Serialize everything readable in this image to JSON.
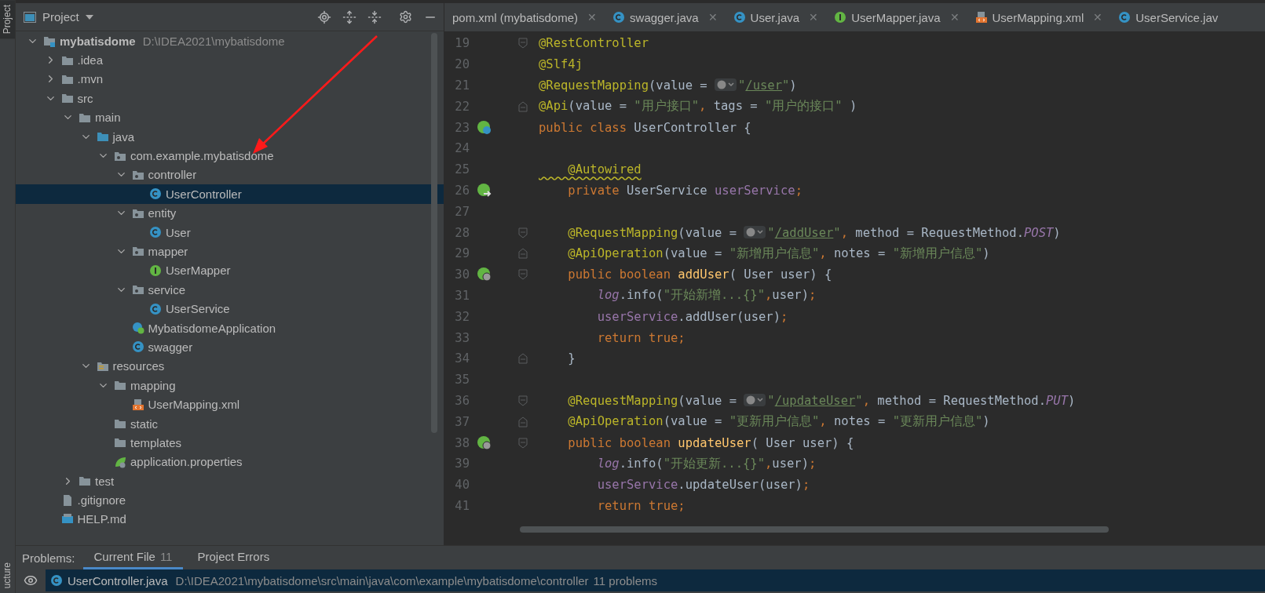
{
  "side_strip": {
    "top_tab": {
      "label": "Project",
      "selected": true
    },
    "bottom_tab": {
      "label": "ucture",
      "selected": false
    }
  },
  "project_panel": {
    "title": "Project",
    "tree": [
      {
        "label": "mybatisdome",
        "path": "D:\\IDEA2021\\mybatisdome",
        "kind": "module",
        "expanded": true,
        "selected": false,
        "children": [
          {
            "label": ".idea",
            "kind": "folder",
            "expanded": false,
            "selected": false
          },
          {
            "label": ".mvn",
            "kind": "folder",
            "expanded": false,
            "selected": false
          },
          {
            "label": "src",
            "kind": "folder",
            "expanded": true,
            "selected": false,
            "children": [
              {
                "label": "main",
                "kind": "folder",
                "expanded": true,
                "selected": false,
                "children": [
                  {
                    "label": "java",
                    "kind": "source",
                    "expanded": true,
                    "selected": false,
                    "children": [
                      {
                        "label": "com.example.mybatisdome",
                        "kind": "package",
                        "expanded": true,
                        "selected": false,
                        "children": [
                          {
                            "label": "controller",
                            "kind": "package",
                            "expanded": true,
                            "selected": false,
                            "children": [
                              {
                                "label": "UserController",
                                "kind": "class",
                                "selected": true
                              }
                            ]
                          },
                          {
                            "label": "entity",
                            "kind": "package",
                            "expanded": true,
                            "selected": false,
                            "children": [
                              {
                                "label": "User",
                                "kind": "class",
                                "selected": false
                              }
                            ]
                          },
                          {
                            "label": "mapper",
                            "kind": "package",
                            "expanded": true,
                            "selected": false,
                            "children": [
                              {
                                "label": "UserMapper",
                                "kind": "interface",
                                "selected": false
                              }
                            ]
                          },
                          {
                            "label": "service",
                            "kind": "package",
                            "expanded": true,
                            "selected": false,
                            "children": [
                              {
                                "label": "UserService",
                                "kind": "class",
                                "selected": false
                              }
                            ]
                          },
                          {
                            "label": "MybatisdomeApplication",
                            "kind": "app",
                            "selected": false
                          },
                          {
                            "label": "swagger",
                            "kind": "class",
                            "selected": false
                          }
                        ]
                      }
                    ]
                  },
                  {
                    "label": "resources",
                    "kind": "resources",
                    "expanded": true,
                    "selected": false,
                    "children": [
                      {
                        "label": "mapping",
                        "kind": "folder",
                        "expanded": true,
                        "selected": false,
                        "children": [
                          {
                            "label": "UserMapping.xml",
                            "kind": "xml",
                            "selected": false
                          }
                        ]
                      },
                      {
                        "label": "static",
                        "kind": "folder",
                        "selected": false
                      },
                      {
                        "label": "templates",
                        "kind": "folder",
                        "selected": false
                      },
                      {
                        "label": "application.properties",
                        "kind": "properties",
                        "selected": false
                      }
                    ]
                  }
                ]
              },
              {
                "label": "test",
                "kind": "folder",
                "expanded": false,
                "selected": false
              }
            ]
          },
          {
            "label": ".gitignore",
            "kind": "file",
            "selected": false
          },
          {
            "label": "HELP.md",
            "kind": "markdown",
            "selected": false
          }
        ]
      }
    ]
  },
  "editor_tabs": [
    {
      "label": "pom.xml (mybatisdome)",
      "kind": "plain",
      "selected": false,
      "close": "✕"
    },
    {
      "label": "swagger.java",
      "kind": "class",
      "selected": false,
      "close": "✕"
    },
    {
      "label": "User.java",
      "kind": "class",
      "selected": false,
      "close": "✕"
    },
    {
      "label": "UserMapper.java",
      "kind": "interface",
      "selected": false,
      "close": "✕"
    },
    {
      "label": "UserMapping.xml",
      "kind": "xml",
      "selected": false,
      "close": "✕"
    },
    {
      "label": "UserService.jav",
      "kind": "class",
      "selected": false
    }
  ],
  "code_lines": [
    {
      "number": "19",
      "fold_start": true,
      "tokens": [
        {
          "kind": "annotation",
          "t": "@RestController"
        }
      ]
    },
    {
      "number": "20",
      "tokens": [
        {
          "kind": "annotation",
          "t": "@Slf4j"
        }
      ]
    },
    {
      "number": "21",
      "tokens": [
        {
          "kind": "annotation",
          "t": "@RequestMapping"
        },
        {
          "kind": "plain",
          "t": "(value = "
        },
        {
          "kind": "globe"
        },
        {
          "kind": "string",
          "t": "\""
        },
        {
          "kind": "url",
          "t": "/user"
        },
        {
          "kind": "string",
          "t": "\""
        },
        {
          "kind": "plain",
          "t": ")"
        }
      ]
    },
    {
      "number": "22",
      "fold_end": true,
      "tokens": [
        {
          "kind": "annotation",
          "t": "@Api"
        },
        {
          "kind": "plain",
          "t": "(value = "
        },
        {
          "kind": "string",
          "t": "\"用户接口\""
        },
        {
          "kind": "keyword",
          "t": ","
        },
        {
          "kind": "plain",
          "t": " tags = "
        },
        {
          "kind": "string",
          "t": "\"用户的接口\""
        },
        {
          "kind": "plain",
          "t": " )"
        }
      ]
    },
    {
      "number": "23",
      "gutter": {
        "kind": "bean"
      },
      "tokens": [
        {
          "kind": "keyword",
          "t": "public class "
        },
        {
          "kind": "plain",
          "t": "UserController {"
        }
      ]
    },
    {
      "number": "24"
    },
    {
      "number": "25",
      "tokens": [
        {
          "kind": "warning",
          "t": "    @Autowired"
        }
      ]
    },
    {
      "number": "26",
      "gutter": {
        "kind": "inject"
      },
      "tokens": [
        {
          "kind": "keyword",
          "t": "    private "
        },
        {
          "kind": "plain",
          "t": "UserService "
        },
        {
          "kind": "field",
          "t": "userService"
        },
        {
          "kind": "keyword",
          "t": ";"
        }
      ]
    },
    {
      "number": "27"
    },
    {
      "number": "28",
      "fold_start": true,
      "tokens": [
        {
          "kind": "annotation",
          "t": "    @RequestMapping"
        },
        {
          "kind": "plain",
          "t": "(value = "
        },
        {
          "kind": "globe"
        },
        {
          "kind": "string",
          "t": "\""
        },
        {
          "kind": "url",
          "t": "/addUser"
        },
        {
          "kind": "string",
          "t": "\""
        },
        {
          "kind": "keyword",
          "t": ","
        },
        {
          "kind": "plain",
          "t": " method = RequestMethod."
        },
        {
          "kind": "constant",
          "t": "POST"
        },
        {
          "kind": "plain",
          "t": ")"
        }
      ]
    },
    {
      "number": "29",
      "fold_end": true,
      "tokens": [
        {
          "kind": "annotation",
          "t": "    @ApiOperation"
        },
        {
          "kind": "plain",
          "t": "(value = "
        },
        {
          "kind": "string",
          "t": "\"新增用户信息\""
        },
        {
          "kind": "keyword",
          "t": ","
        },
        {
          "kind": "plain",
          "t": " notes = "
        },
        {
          "kind": "string",
          "t": "\"新增用户信息\""
        },
        {
          "kind": "plain",
          "t": ")"
        }
      ]
    },
    {
      "number": "30",
      "gutter": {
        "kind": "web"
      },
      "fold_start": true,
      "tokens": [
        {
          "kind": "keyword",
          "t": "    public boolean "
        },
        {
          "kind": "method",
          "t": "addUser"
        },
        {
          "kind": "plain",
          "t": "( User user) {"
        }
      ]
    },
    {
      "number": "31",
      "tokens": [
        {
          "kind": "constant",
          "t": "        log"
        },
        {
          "kind": "plain",
          "t": ".info("
        },
        {
          "kind": "string",
          "t": "\"开始新增...{}\""
        },
        {
          "kind": "keyword",
          "t": ","
        },
        {
          "kind": "plain",
          "t": "user)"
        },
        {
          "kind": "keyword",
          "t": ";"
        }
      ]
    },
    {
      "number": "32",
      "tokens": [
        {
          "kind": "field",
          "t": "        userService"
        },
        {
          "kind": "plain",
          "t": ".addUser(user)"
        },
        {
          "kind": "keyword",
          "t": ";"
        }
      ]
    },
    {
      "number": "33",
      "tokens": [
        {
          "kind": "keyword",
          "t": "        return true;"
        }
      ]
    },
    {
      "number": "34",
      "fold_end": true,
      "tokens": [
        {
          "kind": "plain",
          "t": "    }"
        }
      ]
    },
    {
      "number": "35"
    },
    {
      "number": "36",
      "fold_start": true,
      "tokens": [
        {
          "kind": "annotation",
          "t": "    @RequestMapping"
        },
        {
          "kind": "plain",
          "t": "(value = "
        },
        {
          "kind": "globe"
        },
        {
          "kind": "string",
          "t": "\""
        },
        {
          "kind": "url",
          "t": "/updateUser"
        },
        {
          "kind": "string",
          "t": "\""
        },
        {
          "kind": "keyword",
          "t": ","
        },
        {
          "kind": "plain",
          "t": " method = RequestMethod."
        },
        {
          "kind": "constant",
          "t": "PUT"
        },
        {
          "kind": "plain",
          "t": ")"
        }
      ]
    },
    {
      "number": "37",
      "fold_end": true,
      "tokens": [
        {
          "kind": "annotation",
          "t": "    @ApiOperation"
        },
        {
          "kind": "plain",
          "t": "(value = "
        },
        {
          "kind": "string",
          "t": "\"更新用户信息\""
        },
        {
          "kind": "keyword",
          "t": ","
        },
        {
          "kind": "plain",
          "t": " notes = "
        },
        {
          "kind": "string",
          "t": "\"更新用户信息\""
        },
        {
          "kind": "plain",
          "t": ")"
        }
      ]
    },
    {
      "number": "38",
      "gutter": {
        "kind": "web"
      },
      "fold_start": true,
      "tokens": [
        {
          "kind": "keyword",
          "t": "    public boolean "
        },
        {
          "kind": "method",
          "t": "updateUser"
        },
        {
          "kind": "plain",
          "t": "( User user) {"
        }
      ]
    },
    {
      "number": "39",
      "tokens": [
        {
          "kind": "constant",
          "t": "        log"
        },
        {
          "kind": "plain",
          "t": ".info("
        },
        {
          "kind": "string",
          "t": "\"开始更新...{}\""
        },
        {
          "kind": "keyword",
          "t": ","
        },
        {
          "kind": "plain",
          "t": "user)"
        },
        {
          "kind": "keyword",
          "t": ";"
        }
      ]
    },
    {
      "number": "40",
      "tokens": [
        {
          "kind": "field",
          "t": "        userService"
        },
        {
          "kind": "plain",
          "t": ".updateUser(user)"
        },
        {
          "kind": "keyword",
          "t": ";"
        }
      ]
    },
    {
      "number": "41",
      "tokens": [
        {
          "kind": "keyword",
          "t": "        return true;"
        }
      ]
    }
  ],
  "problems_panel": {
    "label": "Problems:",
    "tabs": [
      {
        "label": "Current File",
        "count": "11",
        "selected": true
      },
      {
        "label": "Project Errors",
        "selected": false
      }
    ],
    "row": {
      "file": "UserController.java",
      "path": "D:\\IDEA2021\\mybatisdome\\src\\main\\java\\com\\example\\mybatisdome\\controller",
      "count": "11 problems",
      "selected": true
    }
  }
}
